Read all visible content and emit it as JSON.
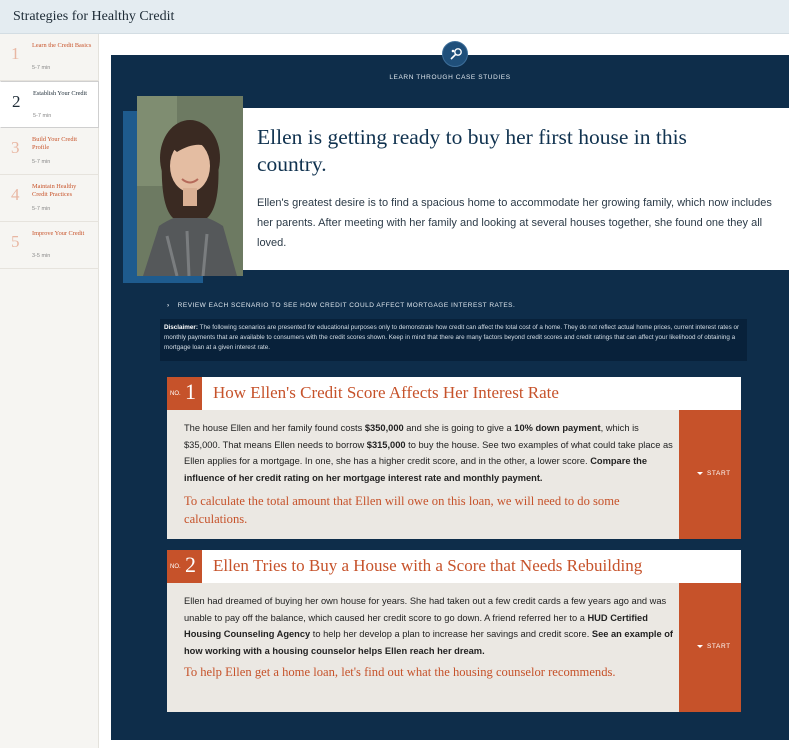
{
  "app": {
    "title": "Strategies for Healthy Credit"
  },
  "sidebar": {
    "modules": [
      {
        "num": "1",
        "label": "Learn the Credit Basics",
        "time": "5-7 min",
        "active": false
      },
      {
        "num": "2",
        "label": "Establish Your Credit",
        "time": "5-7 min",
        "active": true
      },
      {
        "num": "3",
        "label": "Build Your Credit Profile",
        "time": "5-7 min",
        "active": false
      },
      {
        "num": "4",
        "label": "Maintain Healthy Credit Practices",
        "time": "5-7 min",
        "active": false
      },
      {
        "num": "5",
        "label": "Improve Your Credit",
        "time": "3-5 min",
        "active": false
      }
    ]
  },
  "main": {
    "eyebrow": "LEARN THROUGH CASE STUDIES",
    "headline": "Ellen is getting ready to buy her first house in this country.",
    "description": "Ellen's greatest desire is to find a spacious home to accommodate her growing family, which now includes her parents. After meeting with her family and looking at several houses together, she found one they all loved.",
    "review": "REVIEW EACH SCENARIO TO SEE HOW CREDIT COULD AFFECT MORTGAGE INTEREST RATES.",
    "disclaimer_label": "Disclaimer:",
    "disclaimer_text": "The following scenarios are presented for educational purposes only to demonstrate how credit can affect the total cost of a home. They do not reflect actual home prices, current interest rates or monthly payments that are available to consumers with the credit scores shown. Keep in mind that there are many factors beyond credit scores and credit ratings that can affect your likelihood of obtaining a mortgage loan at a given interest rate."
  },
  "scenarios": [
    {
      "no_label": "NO.",
      "number": "1",
      "title": "How Ellen's Credit Score Affects Her Interest Rate",
      "body_parts": [
        "The house Ellen and her family found costs ",
        "$350,000",
        " and she is going to give a ",
        "10% down payment",
        ", which is $35,000. That means Ellen needs to borrow ",
        "$315,000",
        " to buy the house. See two examples of what could take place as Ellen applies for a mortgage. In one, she has a higher credit score, and in the other, a lower score. ",
        "Compare the influence of her credit rating on her mortgage interest rate and monthly payment."
      ],
      "cta": "To calculate the total amount that Ellen will owe on this loan, we will need to do some calculations.",
      "start": "START"
    },
    {
      "no_label": "NO.",
      "number": "2",
      "title": "Ellen Tries to Buy a House with a Score that Needs Rebuilding",
      "body_parts": [
        "Ellen had dreamed of buying her own house for years. She had taken out a few credit cards a few years ago and was unable to pay off the balance, which caused her credit score to go down. A friend referred her to a ",
        "HUD Certified Housing Counseling Agency",
        " to help her develop a plan to increase her savings and credit score. ",
        "See an example of how working with a housing counselor helps Ellen reach her dream."
      ],
      "cta": "To help Ellen get a home loan, let's find out what the housing counselor recommends.",
      "start": "START"
    }
  ],
  "colors": {
    "navy": "#0e2d4a",
    "accent": "#c6522a",
    "panel": "#ebe8e3"
  },
  "icons": {
    "header": "magnifier-people-icon",
    "review": "chevron-right-icon",
    "start": "caret-down-icon"
  }
}
